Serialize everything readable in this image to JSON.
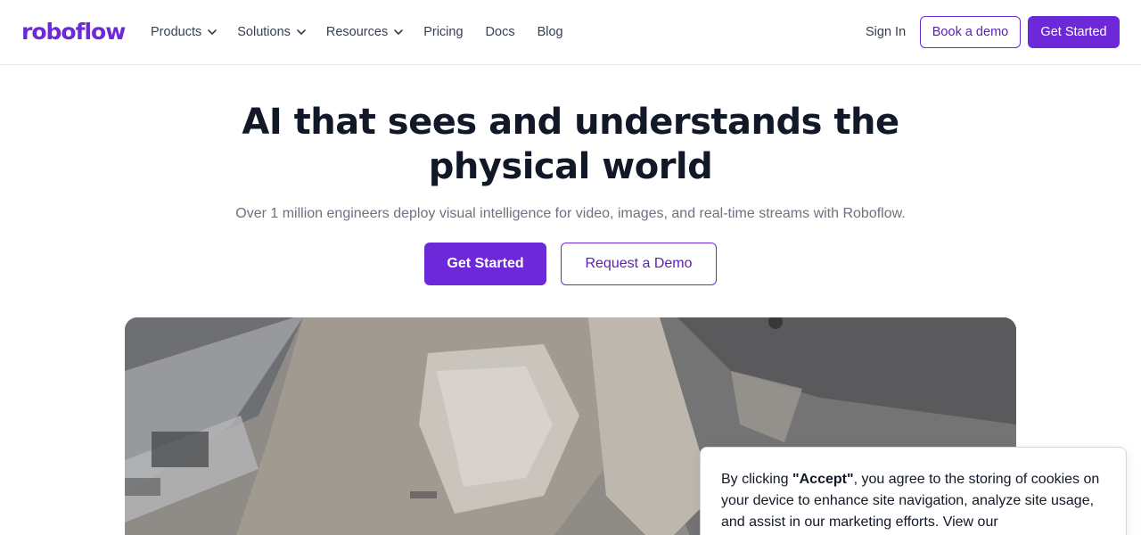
{
  "brand": {
    "logo_text": "roboflow",
    "accent": "#6d28d9"
  },
  "nav": {
    "items": [
      {
        "label": "Products",
        "has_menu": true
      },
      {
        "label": "Solutions",
        "has_menu": true
      },
      {
        "label": "Resources",
        "has_menu": true
      },
      {
        "label": "Pricing",
        "has_menu": false
      },
      {
        "label": "Docs",
        "has_menu": false
      },
      {
        "label": "Blog",
        "has_menu": false
      }
    ],
    "sign_in": "Sign In",
    "book_demo": "Book a demo",
    "get_started": "Get Started",
    "chevron_icon": "chevron-down-icon"
  },
  "hero": {
    "title_line1": "AI that sees and understands the",
    "title_line2": "physical world",
    "subtitle": "Over 1 million engineers deploy visual intelligence for video, images, and real-time streams with Roboflow.",
    "primary_cta": "Get Started",
    "secondary_cta": "Request a Demo"
  },
  "cookie_banner": {
    "prefix": "By clicking ",
    "accept_quote": "\"Accept\"",
    "suffix": ", you agree to the storing of cookies on your device to enhance site navigation, analyze site usage, and assist in our marketing efforts. View our"
  }
}
